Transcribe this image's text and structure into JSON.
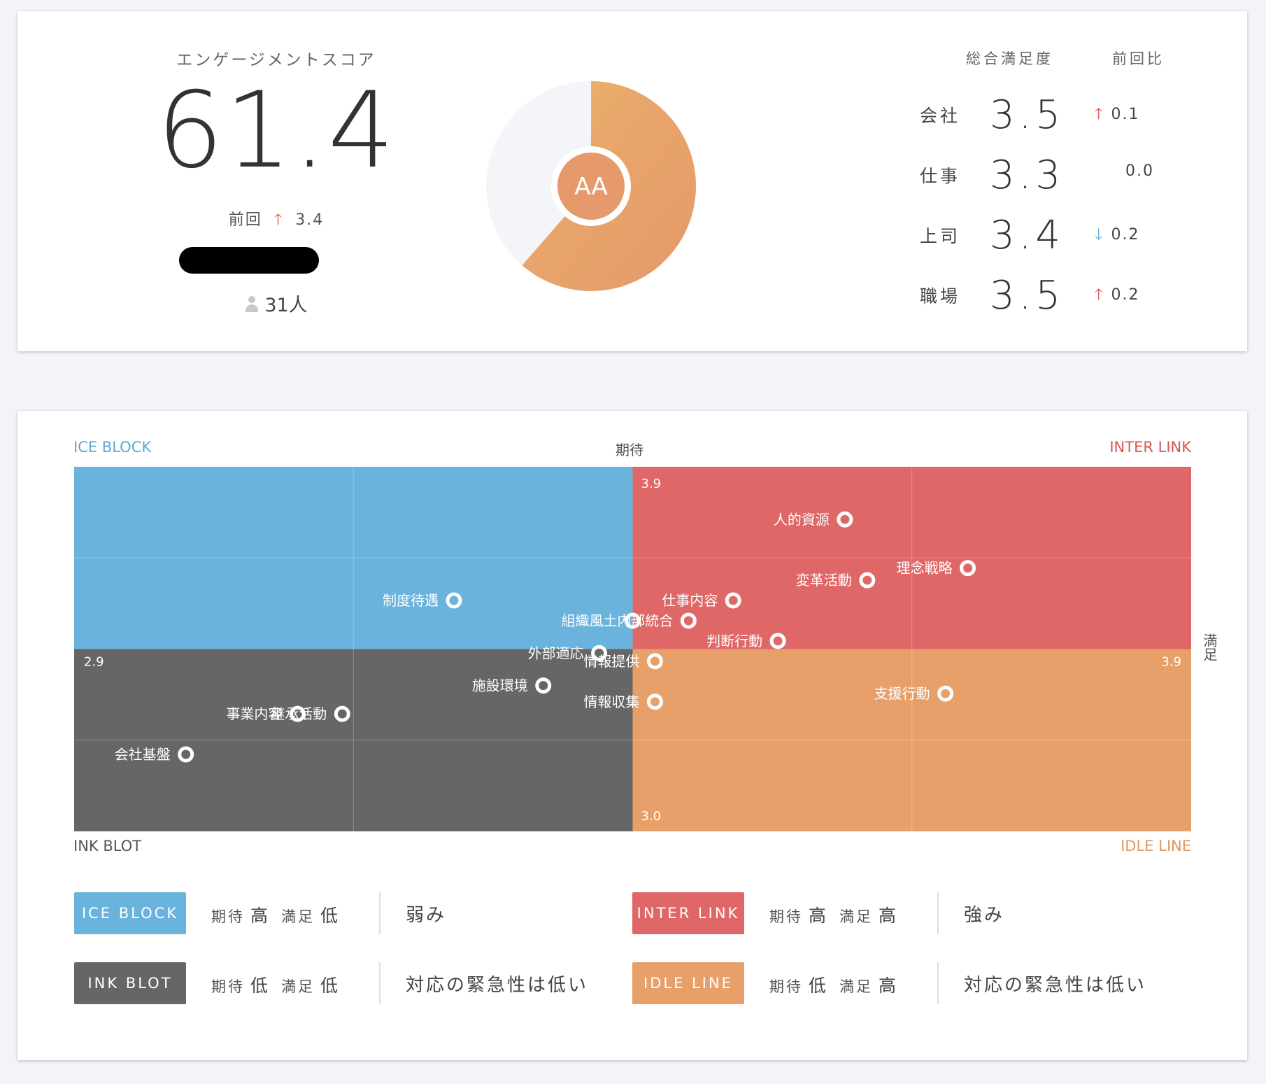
{
  "engagement": {
    "title": "エンゲージメントスコア",
    "score": "61.4",
    "previous_label": "前回",
    "previous_arrow": "up",
    "previous_delta": "3.4",
    "respondents": "31人",
    "grade": "AA",
    "gauge_fill_fraction": 0.614
  },
  "satisfaction": {
    "header_overall": "総合満足度",
    "header_delta": "前回比",
    "rows": [
      {
        "label": "会社",
        "value": "3.5",
        "trend": "up",
        "delta": "0.1"
      },
      {
        "label": "仕事",
        "value": "3.3",
        "trend": "flat",
        "delta": "0.0"
      },
      {
        "label": "上司",
        "value": "3.4",
        "trend": "down",
        "delta": "0.2"
      },
      {
        "label": "職場",
        "value": "3.5",
        "trend": "up",
        "delta": "0.2"
      }
    ]
  },
  "matrix": {
    "top_axis": "期待",
    "right_axis": "満足",
    "corners": {
      "top_left": "ICE BLOCK",
      "top_right": "INTER LINK",
      "bottom_left": "INK BLOT",
      "bottom_right": "IDLE LINE"
    },
    "ticks": {
      "expect_max": "3.9",
      "expect_min": "3.0",
      "satisfy_min": "2.9",
      "satisfy_max": "3.9"
    },
    "colors": {
      "ice_block": "#6ab3dc",
      "inter_link": "#e06767",
      "ink_blot": "#666666",
      "idle_line": "#e8a06a"
    }
  },
  "chart_data": {
    "type": "scatter",
    "xlabel": "満足",
    "ylabel": "期待",
    "xlim": [
      2.9,
      3.9
    ],
    "ylim": [
      3.0,
      3.9
    ],
    "x_mid": 3.4,
    "y_mid": 3.45,
    "points": [
      {
        "label": "人的資源",
        "x": 3.59,
        "y": 3.77
      },
      {
        "label": "理念戦略",
        "x": 3.7,
        "y": 3.65
      },
      {
        "label": "変革活動",
        "x": 3.61,
        "y": 3.62
      },
      {
        "label": "仕事内容",
        "x": 3.49,
        "y": 3.57
      },
      {
        "label": "制度待遇",
        "x": 3.24,
        "y": 3.57
      },
      {
        "label": "組織風土",
        "x": 3.4,
        "y": 3.52
      },
      {
        "label": "内部統合",
        "x": 3.45,
        "y": 3.52
      },
      {
        "label": "判断行動",
        "x": 3.53,
        "y": 3.47
      },
      {
        "label": "外部適応",
        "x": 3.37,
        "y": 3.44
      },
      {
        "label": "情報提供",
        "x": 3.42,
        "y": 3.42
      },
      {
        "label": "施設環境",
        "x": 3.32,
        "y": 3.36
      },
      {
        "label": "支援行動",
        "x": 3.68,
        "y": 3.34
      },
      {
        "label": "情報収集",
        "x": 3.42,
        "y": 3.32
      },
      {
        "label": "事業内容",
        "x": 3.1,
        "y": 3.29
      },
      {
        "label": "継承活動",
        "x": 3.14,
        "y": 3.29
      },
      {
        "label": "会社基盤",
        "x": 3.0,
        "y": 3.19
      }
    ]
  },
  "legend": [
    {
      "badge": "ICE BLOCK",
      "color": "#6ab3dc",
      "expect_label": "期待",
      "expect": "高",
      "satisfy_label": "満足",
      "satisfy": "低",
      "desc": "弱み"
    },
    {
      "badge": "INTER LINK",
      "color": "#e06767",
      "expect_label": "期待",
      "expect": "高",
      "satisfy_label": "満足",
      "satisfy": "高",
      "desc": "強み"
    },
    {
      "badge": "INK BLOT",
      "color": "#666666",
      "expect_label": "期待",
      "expect": "低",
      "satisfy_label": "満足",
      "satisfy": "低",
      "desc": "対応の緊急性は低い"
    },
    {
      "badge": "IDLE LINE",
      "color": "#e8a06a",
      "expect_label": "期待",
      "expect": "低",
      "satisfy_label": "満足",
      "satisfy": "高",
      "desc": "対応の緊急性は低い"
    }
  ]
}
